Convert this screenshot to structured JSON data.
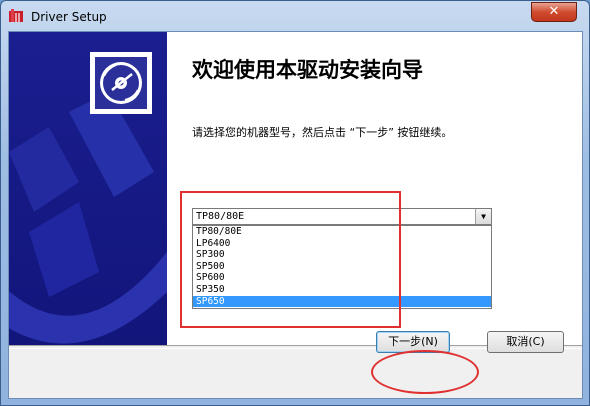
{
  "window": {
    "title": "Driver Setup",
    "close_glyph": "✕"
  },
  "content": {
    "heading": "欢迎使用本驱动安装向导",
    "instruction": "请选择您的机器型号，然后点击 “下一步” 按钮继续。"
  },
  "model_select": {
    "selected_value": "TP80/80E",
    "arrow_glyph": "▼",
    "options": [
      "TP80/80E",
      "LP6400",
      "SP300",
      "SP500",
      "SP600",
      "SP350",
      "SP650"
    ],
    "highlighted_option": "SP650"
  },
  "buttons": {
    "next_label": "下一步(N)",
    "cancel_label": "取消(C)"
  },
  "colors": {
    "sidebar": "#1b1e8c",
    "selection": "#3399ff",
    "annotation": "#e03030"
  }
}
